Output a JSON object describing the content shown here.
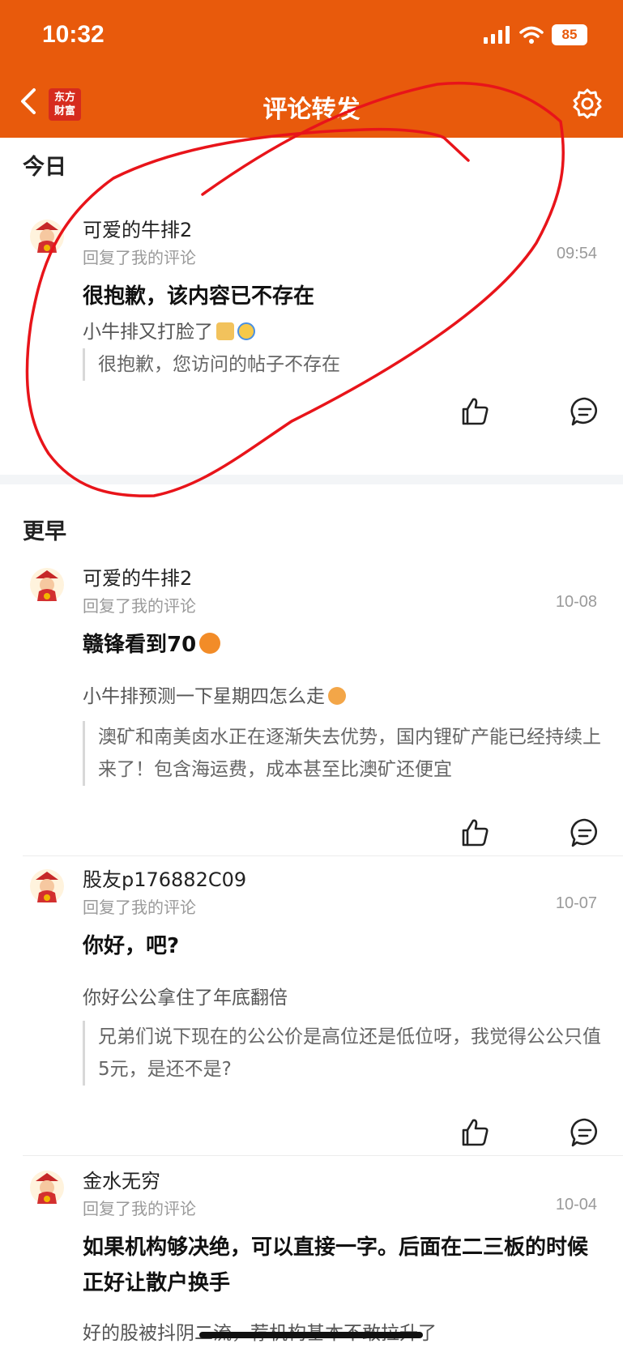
{
  "status_bar": {
    "time": "10:32",
    "battery": "85"
  },
  "nav": {
    "logo_line1": "东方",
    "logo_line2": "财富",
    "title": "评论转发"
  },
  "sections": {
    "today": "今日",
    "earlier": "更早"
  },
  "items": [
    {
      "username": "可爱的牛排2",
      "reply_label": "回复了我的评论",
      "date": "09:54",
      "headline": "很抱歉，该内容已不存在",
      "comment": "小牛排又打脸了",
      "quote": "很抱歉，您访问的帖子不存在"
    },
    {
      "username": "可爱的牛排2",
      "reply_label": "回复了我的评论",
      "date": "10-08",
      "headline": "赣锋看到70",
      "comment": "小牛排预测一下星期四怎么走",
      "quote": "澳矿和南美卤水正在逐渐失去优势，国内锂矿产能已经持续上来了！包含海运费，成本甚至比澳矿还便宜"
    },
    {
      "username": "股友p176882C09",
      "reply_label": "回复了我的评论",
      "date": "10-07",
      "headline": "你好，吧?",
      "comment": "你好公公拿住了年底翻倍",
      "quote": "兄弟们说下现在的公公价是高位还是低位呀，我觉得公公只值5元，是还不是?"
    },
    {
      "username": "金水无穷",
      "reply_label": "回复了我的评论",
      "date": "10-04",
      "headline": "如果机构够决绝，可以直接一字。后面在二三板的时候正好让散户换手",
      "comment": "好的股被抖阴二流，荐机构基本不敢拉升了"
    }
  ],
  "colors": {
    "brand": "#e85a0c",
    "annotation": "#e8141a"
  },
  "icons": [
    "back-chevron-icon",
    "settings-gear-icon",
    "thumbs-up-icon",
    "comment-bubble-icon"
  ]
}
